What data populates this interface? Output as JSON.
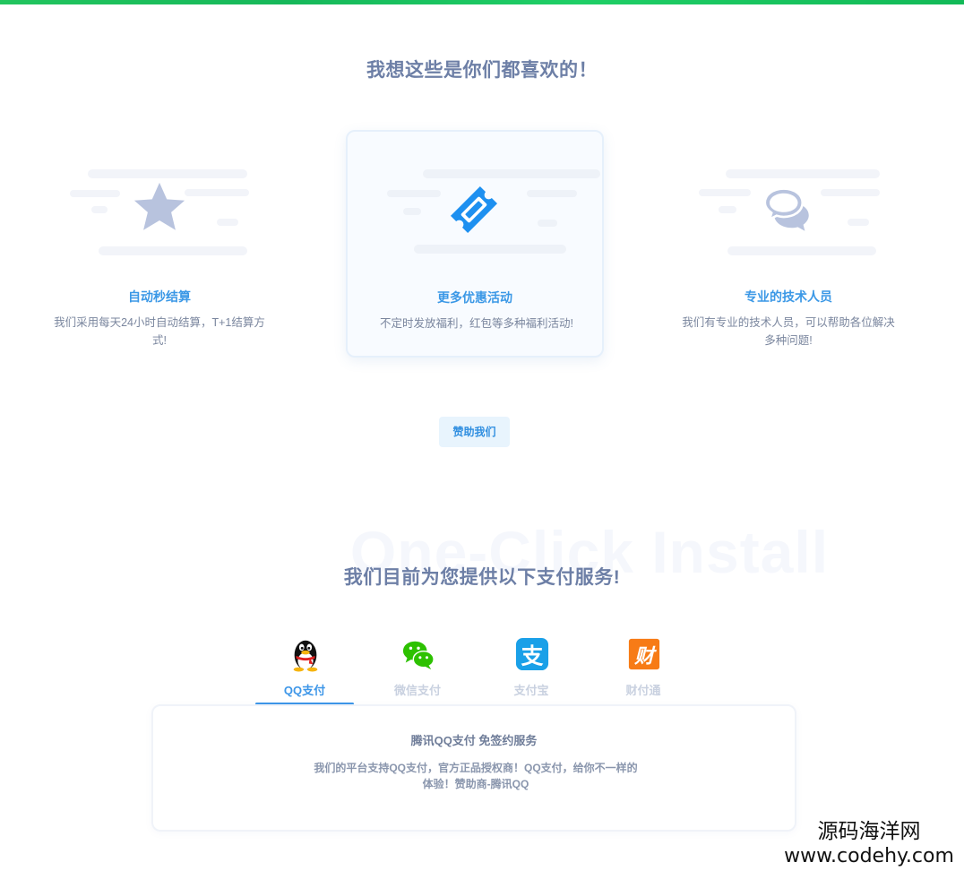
{
  "section1": {
    "title": "我想这些是你们都喜欢的！",
    "features": [
      {
        "icon": "star-icon",
        "title": "自动秒结算",
        "desc": "我们采用每天24小时自动结算，T+1结算方式!"
      },
      {
        "icon": "ticket-icon",
        "title": "更多优惠活动",
        "desc": "不定时发放福利，红包等多种福利活动!"
      },
      {
        "icon": "chat-bubbles-icon",
        "title": "专业的技术人员",
        "desc": "我们有专业的技术人员，可以帮助各位解决多种问题!"
      }
    ],
    "sponsor_label": "赞助我们"
  },
  "section2": {
    "watermark": "One-Click Install",
    "title": "我们目前为您提供以下支付服务!",
    "tabs": [
      {
        "icon": "qq-penguin-icon",
        "label": "QQ支付",
        "active": true
      },
      {
        "icon": "wechat-icon",
        "label": "微信支付",
        "active": false
      },
      {
        "icon": "alipay-icon",
        "label": "支付宝",
        "active": false
      },
      {
        "icon": "tenpay-icon",
        "label": "财付通",
        "active": false
      }
    ],
    "panel": {
      "title": "腾讯QQ支付 免签约服务",
      "desc": "我们的平台支持QQ支付，官方正品授权商！QQ支付，给你不一样的体验！赞助商-腾讯QQ"
    }
  },
  "site_mark": {
    "cn": "源码海洋网",
    "url": "www.codehy.com"
  },
  "colors": {
    "accent": "#3d96e8",
    "top_bar": "#22c55e",
    "title": "#6d7fa6",
    "alipay": "#1aa0e8",
    "tenpay": "#f77b16",
    "wechat": "#2dc100"
  }
}
